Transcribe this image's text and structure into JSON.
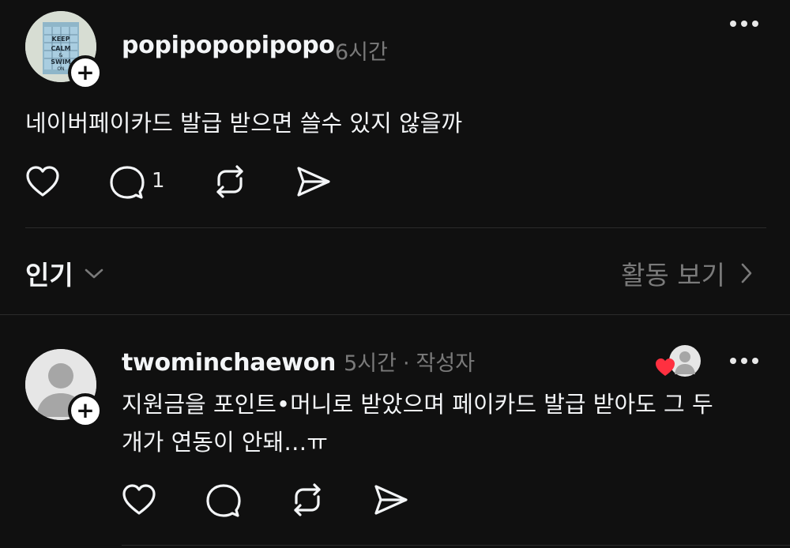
{
  "post": {
    "username": "popipopopipopo",
    "time": "6시간",
    "text": "네이버페이카드 발급 받으면 쓸수 있지 않을까",
    "reply_count": "1",
    "avatar_text": {
      "line1": "KEEP",
      "line2": "CALM",
      "line3": "&",
      "line4": "SWIM",
      "line5": "ON"
    }
  },
  "sort": {
    "label": "인기",
    "activity_label": "활동 보기"
  },
  "reply": {
    "username": "twominchaewon",
    "time": "5시간",
    "separator": "·",
    "author_badge": "작성자",
    "text_line1": "지원금을 포인트•머니로 받았으며 페이카드 발급 받아도 그 두",
    "text_line2": "개가 연동이  안돼…ㅠ"
  },
  "colors": {
    "background": "#101010",
    "text": "#f3f5f7",
    "muted": "#7a7a7a",
    "like_heart": "#ff3040"
  }
}
